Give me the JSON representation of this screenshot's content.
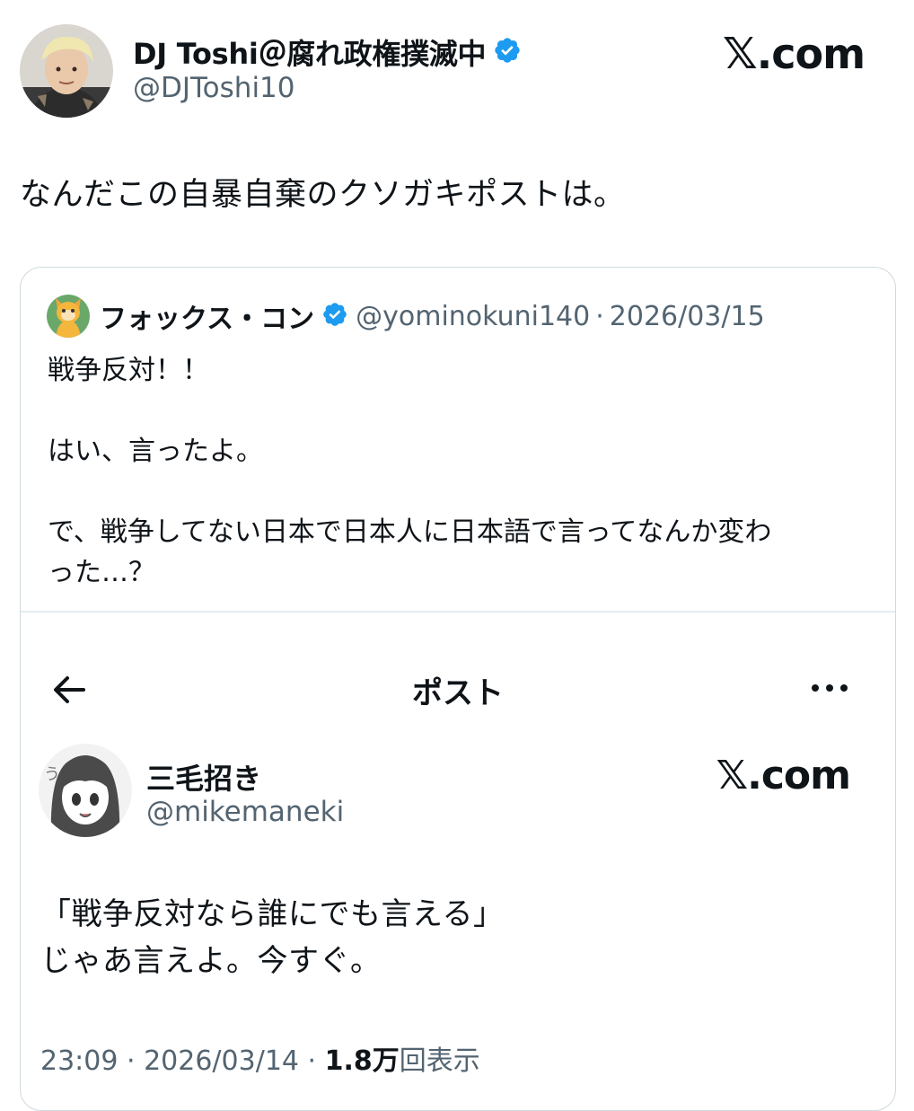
{
  "author": {
    "name": "DJ Toshi＠腐れ政権撲滅中",
    "handle": "@DJToshi10",
    "verified": true
  },
  "brand": {
    "logo_text": ".com",
    "logo_mark": "𝕏"
  },
  "post": {
    "text": "なんだこの自暴自棄のクソガキポストは。"
  },
  "quoted": {
    "name": "フォックス・コン",
    "verified": true,
    "handle": "@yominokuni140",
    "separator": "·",
    "date": "2026/03/15",
    "lines": [
      "戦争反対！！",
      "",
      "はい、言ったよ。",
      "",
      "で、戦争してない日本で日本人に日本語で言ってなんか変わ",
      "った…？"
    ]
  },
  "embedded": {
    "nav_title": "ポスト",
    "name": "三毛招き",
    "handle": "@mikemaneki",
    "logo_text": ".com",
    "logo_mark": "𝕏",
    "lines": [
      "「戦争反対なら誰にでも言える」",
      "じゃあ言えよ。今すぐ。"
    ],
    "time": "23:09",
    "sep1": " · ",
    "date": "2026/03/14",
    "sep2": " · ",
    "views": "1.8万",
    "views_label": "回表示"
  },
  "colors": {
    "text": "#0f1419",
    "secondary": "#536471",
    "verified_blue": "#1d9bf0",
    "border": "#cfd9de"
  },
  "icons": [
    "verified-badge-icon",
    "back-arrow-icon",
    "more-options-icon"
  ]
}
